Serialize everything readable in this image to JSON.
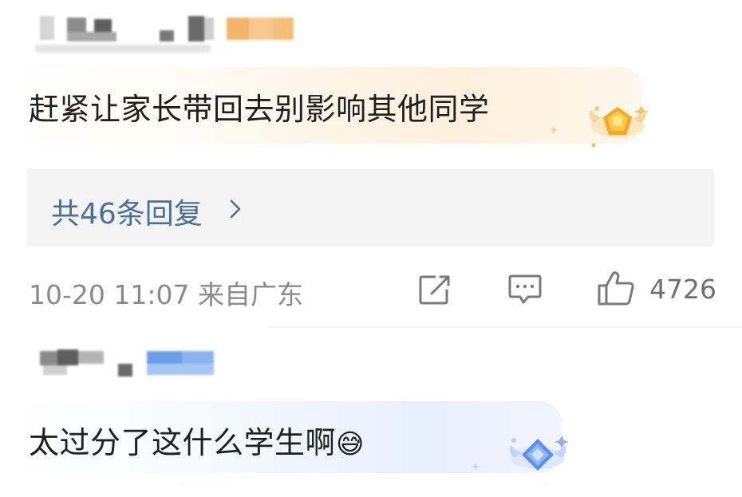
{
  "comments": [
    {
      "text": "赶紧让家长带回去别影响其他同学",
      "badge": "gold-medal-icon",
      "replies_label": "共46条回复",
      "timestamp": "10-20 11:07",
      "location": "来自广东",
      "like_count": "4726"
    },
    {
      "text": "太过分了这什么学生啊",
      "emoji": "😅",
      "badge": "blue-diamond-icon"
    }
  ],
  "colors": {
    "reply_link": "#4a6f9a",
    "meta_text": "#8a8a8a",
    "comment_text": "#1f1f1f",
    "replies_bg": "#f4f4f4"
  }
}
